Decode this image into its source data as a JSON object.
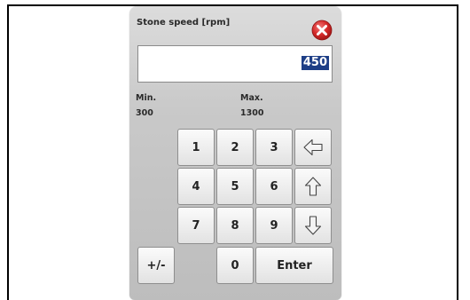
{
  "dialog": {
    "title": "Stone speed [rpm]",
    "close_icon": "close-icon"
  },
  "display": {
    "value": "450"
  },
  "limits": {
    "min_label": "Min.",
    "min_value": "300",
    "max_label": "Max.",
    "max_value": "1300"
  },
  "keypad": {
    "keys": {
      "k1": "1",
      "k2": "2",
      "k3": "3",
      "k4": "4",
      "k5": "5",
      "k6": "6",
      "k7": "7",
      "k8": "8",
      "k9": "9",
      "k0": "0",
      "sign": "+/-",
      "enter": "Enter"
    },
    "icons": {
      "left": "arrow-left-icon",
      "up": "arrow-up-icon",
      "down": "arrow-down-icon"
    }
  },
  "colors": {
    "close_red": "#d42a2a",
    "selection": "#1d3e86"
  }
}
